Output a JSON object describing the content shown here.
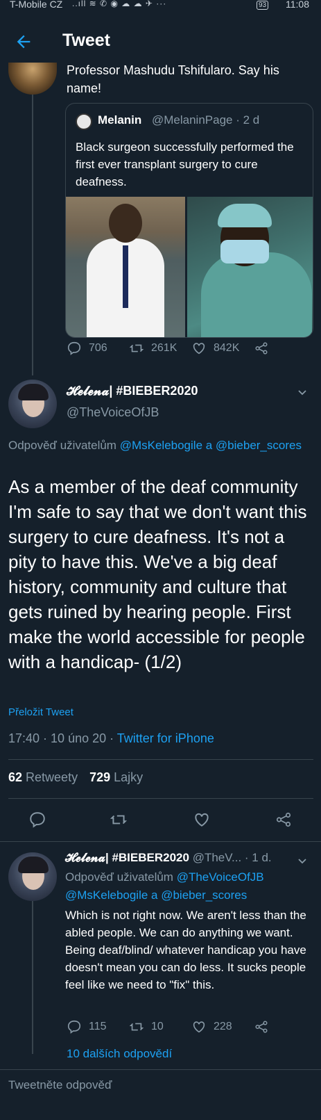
{
  "status_bar": {
    "carrier": "T-Mobile CZ",
    "icons": "..ıll ≋ ✆ ◉ ☁ ☁ ✈ ···",
    "battery": "93",
    "time": "11:08"
  },
  "header": {
    "title": "Tweet"
  },
  "top_tweet": {
    "text": "Professor Mashudu Tshifularo. Say his name!",
    "quote": {
      "name": "Melanin",
      "handle": "@MelaninPage · 2 d",
      "text": "Black surgeon successfully performed the first ever transplant surgery to cure deafness."
    },
    "actions": {
      "replies": "706",
      "retweets": "261K",
      "likes": "842K"
    }
  },
  "main_tweet": {
    "name": "𝓗𝓮𝓵𝓮𝓷𝓪| #BIEBER2020",
    "handle": "@TheVoiceOfJB",
    "reply_prefix": "Odpověď uživatelům ",
    "reply_users": "@MsKelebogile a @bieber_scores",
    "text": "As a member of the deaf community I'm safe to say that we don't want this surgery to cure deafness. It's not a pity to have this. We've a big deaf history, community and culture that gets ruined by hearing people. First make the world accessible for people with a handicap- (1/2)",
    "translate": "Přeložit Tweet",
    "meta_time": "17:40 · 10 úno 20 · ",
    "meta_source": "Twitter for iPhone",
    "retweets_count": "62",
    "retweets_label": " Retweety",
    "likes_count": "729",
    "likes_label": " Lajky"
  },
  "reply_tweet": {
    "name": "𝓗𝓮𝓵𝓮𝓷𝓪| #BIEBER2020",
    "handle_time": " @TheV... · 1 d.",
    "reply_prefix": "Odpověď uživatelům ",
    "reply_users": "@TheVoiceOfJB @MsKelebogile a @bieber_scores",
    "text": "Which is not right now. We aren't less than the abled people. We can do anything we want. Being deaf/blind/ whatever handicap you have doesn't mean you can do less. It sucks people feel like we need to \"fix\" this.",
    "actions": {
      "replies": "115",
      "retweets": "10",
      "likes": "228"
    },
    "more_replies": "10 dalších odpovědí"
  },
  "compose": {
    "placeholder": "Tweetněte odpověď"
  },
  "colors": {
    "background": "#15202b",
    "accent": "#1da1f2",
    "muted": "#8899a6",
    "border": "#38444d"
  }
}
